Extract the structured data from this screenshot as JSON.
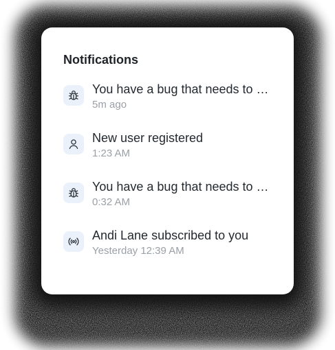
{
  "panel": {
    "title": "Notifications"
  },
  "notifications": [
    {
      "icon": "bug-icon",
      "message": "You have a bug that needs to be fixed.",
      "time": "5m ago"
    },
    {
      "icon": "user-icon",
      "message": "New user registered",
      "time": "1:23 AM"
    },
    {
      "icon": "bug-icon",
      "message": "You have a bug that needs to be fixed.",
      "time": "0:32 AM"
    },
    {
      "icon": "broadcast-icon",
      "message": "Andi Lane subscribed to you",
      "time": "Yesterday 12:39 AM"
    }
  ],
  "colors": {
    "icon_bg": "#eaf1fb",
    "text": "#24292f",
    "muted": "#9aa0a6",
    "card": "#ffffff"
  }
}
